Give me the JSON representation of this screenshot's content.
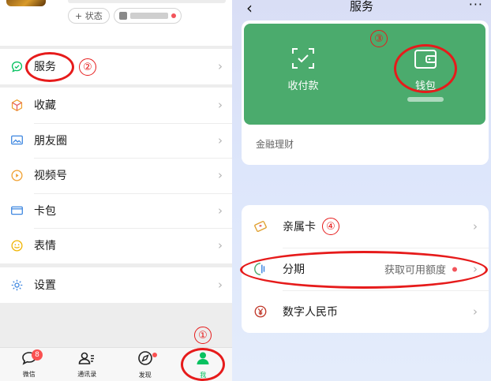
{
  "me_page": {
    "profile": {
      "status_label": "+ 状态"
    },
    "menu": [
      {
        "id": "services",
        "label": "服务",
        "icon": "services-icon"
      },
      {
        "id": "favorites",
        "label": "收藏",
        "icon": "cube-icon"
      },
      {
        "id": "moments",
        "label": "朋友圈",
        "icon": "picture-icon"
      },
      {
        "id": "channels",
        "label": "视频号",
        "icon": "play-circle-icon"
      },
      {
        "id": "cards",
        "label": "卡包",
        "icon": "card-icon"
      },
      {
        "id": "stickers",
        "label": "表情",
        "icon": "smile-icon"
      },
      {
        "id": "settings",
        "label": "设置",
        "icon": "gear-icon"
      }
    ],
    "tabbar": [
      {
        "label": "微信",
        "badge": "8"
      },
      {
        "label": "通讯录"
      },
      {
        "label": "发现"
      },
      {
        "label": "我"
      }
    ]
  },
  "services_page": {
    "title": "服务",
    "more": "···",
    "back": "‹",
    "green_panel": {
      "pay_label": "收付款",
      "wallet_label": "钱包"
    },
    "finance_label": "金融理财",
    "list": [
      {
        "id": "family-card",
        "label": "亲属卡",
        "icon": "family-card-icon"
      },
      {
        "id": "installment",
        "label": "分期",
        "icon": "installment-icon",
        "right_text": "获取可用额度"
      },
      {
        "id": "ecny",
        "label": "数字人民币",
        "icon": "yuan-icon"
      }
    ]
  },
  "annotations": [
    "①",
    "②",
    "③",
    "④"
  ],
  "colors": {
    "wechat_green": "#4bab6d",
    "annotation_red": "#e61b1b",
    "badge_red": "#fa5151"
  }
}
